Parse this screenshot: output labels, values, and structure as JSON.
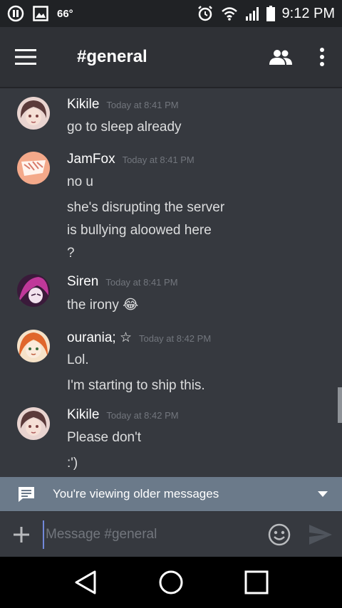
{
  "status_bar": {
    "temperature": "66°",
    "time": "9:12 PM",
    "icons": [
      "pause-icon",
      "image-icon",
      "alarm-icon",
      "wifi-icon",
      "signal-icon",
      "battery-icon"
    ]
  },
  "header": {
    "channel": "#general",
    "icons": [
      "menu-icon",
      "members-icon",
      "more-vert-icon"
    ]
  },
  "messages": [
    {
      "username": "Kikile",
      "timestamp": "Today at 8:41 PM",
      "lines": [
        "go to sleep already"
      ]
    },
    {
      "username": "JamFox",
      "timestamp": "Today at 8:41 PM",
      "lines": [
        "no u",
        "she's disrupting the server",
        "is bullying aloowed here",
        "?"
      ]
    },
    {
      "username": "Siren",
      "timestamp": "Today at 8:41 PM",
      "lines": [
        "the irony 😂"
      ]
    },
    {
      "username": "ourania; ☆",
      "timestamp": "Today at 8:42 PM",
      "lines": [
        "Lol.",
        "I'm starting to ship this."
      ]
    },
    {
      "username": "Kikile",
      "timestamp": "Today at 8:42 PM",
      "lines": [
        "Please don't",
        ":')"
      ]
    }
  ],
  "older_banner": {
    "text": "You're viewing older messages"
  },
  "composer": {
    "placeholder": "Message #general"
  },
  "colors": {
    "background": "#36393f",
    "header": "#2f3136",
    "status_bar": "#202225",
    "banner": "#6b7a8a",
    "accent": "#7289da",
    "timestamp": "#72767d"
  }
}
